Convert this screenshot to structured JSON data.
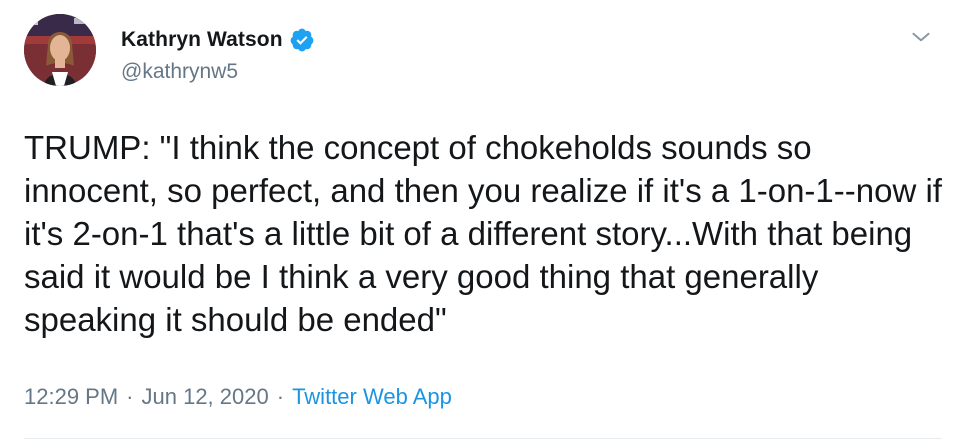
{
  "author": {
    "display_name": "Kathryn Watson",
    "handle": "@kathrynw5",
    "verified": true
  },
  "tweet": {
    "text": "TRUMP: \"I think the concept of chokeholds sounds so innocent, so perfect, and then you realize if it's a 1-on-1--now if it's 2-on-1 that's a little bit of a different story...With that being said it would be I think a very good thing that generally speaking it should be ended\"",
    "time": "12:29 PM",
    "date": "Jun 12, 2020",
    "separator": "·",
    "source": "Twitter Web App"
  },
  "colors": {
    "verified_badge": "#1da1f2",
    "link": "#1b95e0",
    "secondary_text": "#657786"
  },
  "icons": {
    "verified": "verified-badge-icon",
    "menu": "chevron-down-icon"
  }
}
